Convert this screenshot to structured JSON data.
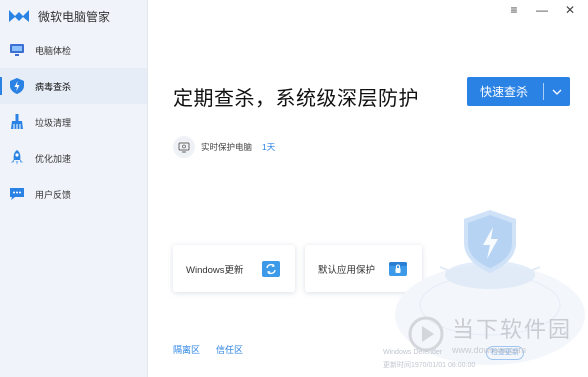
{
  "app": {
    "name": "微软电脑管家"
  },
  "sidebar": {
    "items": [
      {
        "label": "电脑体检",
        "icon": "monitor-icon",
        "active": false
      },
      {
        "label": "病毒查杀",
        "icon": "shield-icon",
        "active": true
      },
      {
        "label": "垃圾清理",
        "icon": "broom-icon",
        "active": false
      },
      {
        "label": "优化加速",
        "icon": "rocket-icon",
        "active": false
      },
      {
        "label": "用户反馈",
        "icon": "feedback-icon",
        "active": false
      }
    ]
  },
  "window_controls": {
    "menu": "≡",
    "minimize": "—",
    "close": "✕"
  },
  "main": {
    "headline": "定期查杀，系统级深层防护",
    "scan_button": {
      "label": "快速查杀",
      "caret": "⌄"
    },
    "protection": {
      "text": "实时保护电脑",
      "days": "1天"
    },
    "cards": [
      {
        "label": "Windows更新",
        "icon": "windows-update-icon"
      },
      {
        "label": "默认应用保护",
        "icon": "app-protect-icon"
      }
    ],
    "links": [
      {
        "label": "隔离区"
      },
      {
        "label": "信任区"
      }
    ],
    "footer": {
      "version_prefix": "Windows Defender",
      "check_label": "检查更新",
      "update_time": "更新时间1970/01/01 08:00:00"
    }
  },
  "watermark": {
    "title": "当下软件园",
    "url": "www.downxia.com"
  },
  "colors": {
    "accent": "#2a82e4",
    "sidebar_bg": "#f0f4fa"
  }
}
